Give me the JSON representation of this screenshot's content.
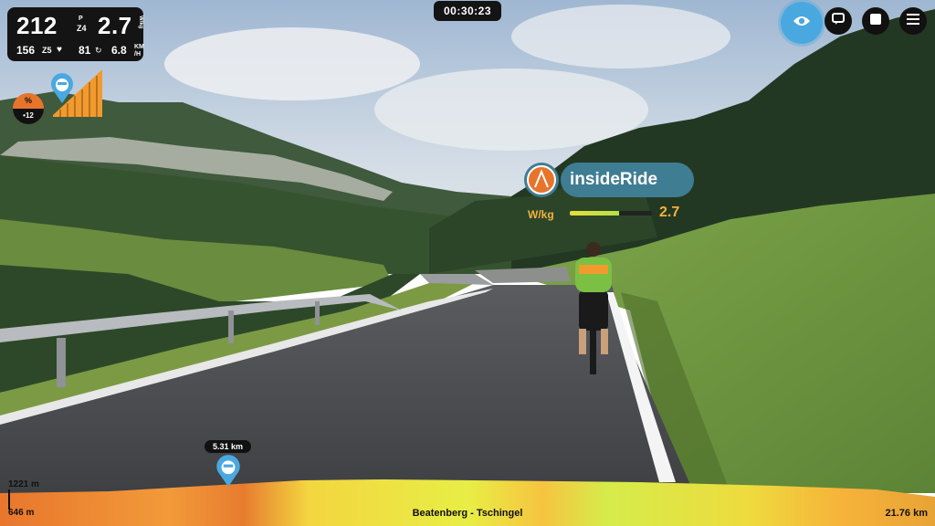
{
  "hud": {
    "power": "212",
    "power_zone_top": "P",
    "power_zone": "Z4",
    "wkg": "2.7",
    "wkg_unit": "W/kg",
    "heart_rate": "156",
    "hr_zone": "Z5",
    "cadence": "81",
    "speed": "6.8",
    "speed_unit_top": "KM",
    "speed_unit_bottom": "/H"
  },
  "timer": "00:30:23",
  "top_buttons": [
    {
      "icon": "eye-icon"
    },
    {
      "icon": "chat-icon"
    },
    {
      "icon": "stop-icon"
    },
    {
      "icon": "menu-icon"
    }
  ],
  "grade": {
    "symbol": "%",
    "value": "•12"
  },
  "rider": {
    "name": "insideRide",
    "wkg_label": "W/kg",
    "wkg_value": "2.7",
    "wkg_fraction": 0.6
  },
  "route": {
    "name": "Beatenberg - Tschingel",
    "rider_distance": "5.31 km",
    "total_distance": "21.76 km",
    "elevation_max": "1221 m",
    "elevation_min": "646 m"
  },
  "colors": {
    "accent_blue": "#4aa8e0",
    "brand_teal": "#3f7d93",
    "wkg_orange": "#f4b23c"
  }
}
